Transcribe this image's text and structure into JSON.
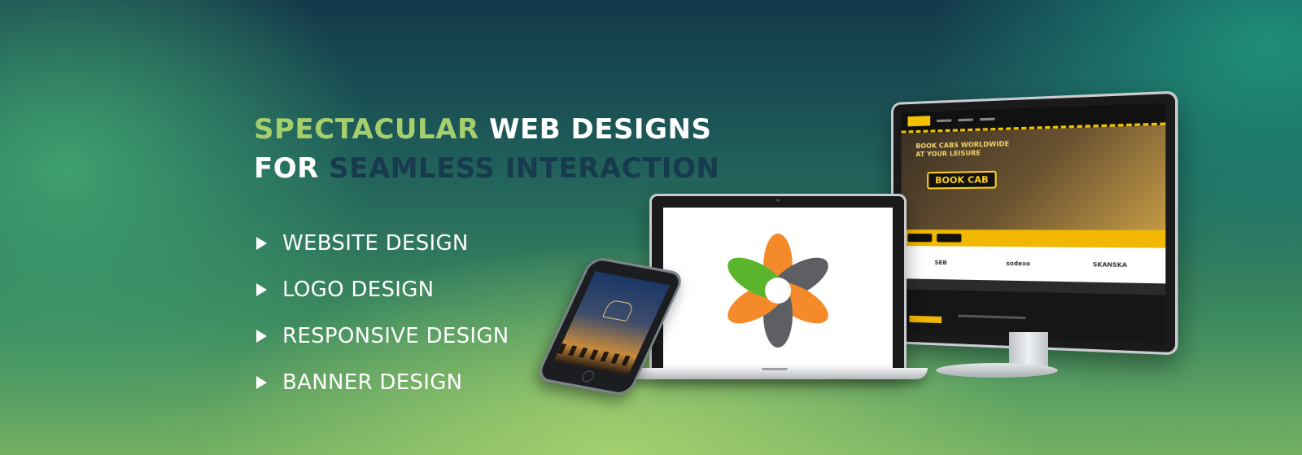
{
  "headline": {
    "line1_part1": "SPECTACULAR",
    "line1_part2": "WEB DESIGNS",
    "line2_part1": "FOR",
    "line2_part2": "SEAMLESS INTERACTION"
  },
  "services": [
    {
      "label": "WEBSITE DESIGN"
    },
    {
      "label": "LOGO DESIGN"
    },
    {
      "label": "RESPONSIVE DESIGN"
    },
    {
      "label": "BANNER DESIGN"
    }
  ],
  "monitor_site": {
    "hero_title_line1": "BOOK CABS WORLDWIDE",
    "hero_title_line2": "AT YOUR LEISURE",
    "cta": "BOOK CAB",
    "clients": [
      "SEB",
      "sodexo",
      "SKANSKA"
    ]
  },
  "colors": {
    "accent_green": "#a5cf6d",
    "dark_teal": "#173a4c",
    "white": "#ffffff",
    "logo_orange": "#f58a2b",
    "logo_gray": "#5d5f62",
    "logo_green": "#5ab52d"
  },
  "icons": {
    "bullet": "play-triangle-icon",
    "laptop_logo": "pinwheel-logo-icon"
  }
}
